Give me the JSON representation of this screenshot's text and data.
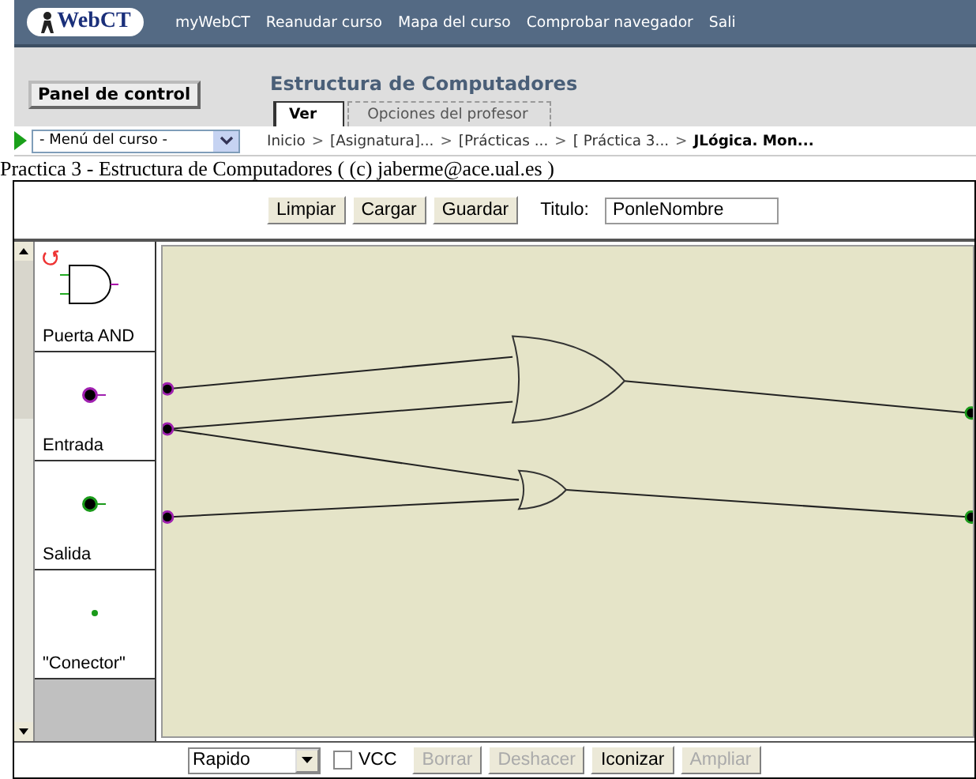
{
  "top_bar": {
    "logo": "WebCT",
    "nav": [
      "myWebCT",
      "Reanudar curso",
      "Mapa del curso",
      "Comprobar navegador",
      "Sali"
    ]
  },
  "header": {
    "panel_button": "Panel de control",
    "course_title": "Estructura de Computadores",
    "tabs": [
      {
        "label": "Ver",
        "selected": true
      },
      {
        "label": "Opciones del profesor",
        "selected": false
      }
    ]
  },
  "course_menu": {
    "value": "- Menú del curso -"
  },
  "breadcrumb": {
    "separator": ">",
    "items": [
      {
        "label": "Inicio",
        "current": false
      },
      {
        "label": "[Asignatura]...",
        "current": false
      },
      {
        "label": "[Prácticas  ...",
        "current": false
      },
      {
        "label": "[ Práctica 3...",
        "current": false
      },
      {
        "label": "JLógica. Mon...",
        "current": true
      }
    ]
  },
  "page_title": "Practica 3 - Estructura de Computadores ( (c) jaberme@ace.ual.es )",
  "toolbar": {
    "buttons": [
      "Limpiar",
      "Cargar",
      "Guardar"
    ],
    "title_label": "Titulo:",
    "title_value": "PonleNombre"
  },
  "palette": [
    {
      "kind": "and",
      "label": "Puerta AND"
    },
    {
      "kind": "input",
      "label": "Entrada"
    },
    {
      "kind": "output",
      "label": "Salida"
    },
    {
      "kind": "connector",
      "label": "\"Conector\""
    }
  ],
  "bottom_bar": {
    "speed": "Rapido",
    "vcc": {
      "label": "VCC",
      "checked": false
    },
    "buttons": [
      {
        "label": "Borrar",
        "disabled": true
      },
      {
        "label": "Deshacer",
        "disabled": true
      },
      {
        "label": "Iconizar",
        "disabled": false
      },
      {
        "label": "Ampliar",
        "disabled": true
      }
    ]
  }
}
